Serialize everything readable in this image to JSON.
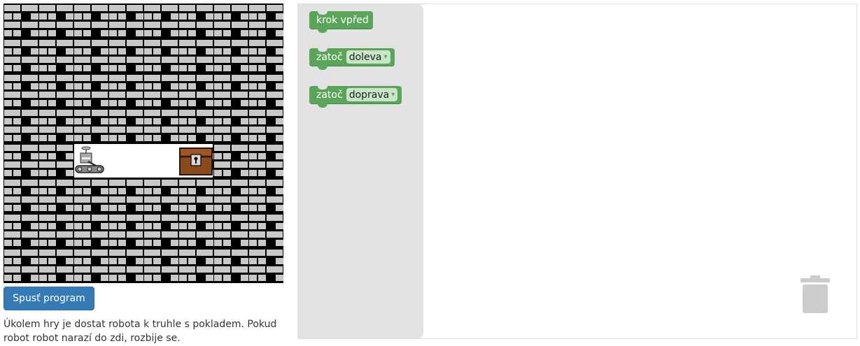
{
  "run_button": {
    "label": "Spusť program"
  },
  "task": {
    "text": "Úkolem hry je dostat robota k truhle s pokladem. Pokud robot robot narazí do zdi, rozbije se."
  },
  "toolbox": {
    "blocks": [
      {
        "label": "krok vpřed"
      },
      {
        "label": "zatoč",
        "value": "doleva"
      },
      {
        "label": "zatoč",
        "value": "doprava"
      }
    ]
  },
  "icons": {
    "dropdown": "▾",
    "trash": "trash-icon",
    "robot": "robot-icon",
    "chest": "treasure-chest-icon"
  },
  "maze": {
    "rows": 8,
    "cols": 8,
    "path_row": 4,
    "path_cols": [
      2,
      3,
      4,
      5
    ],
    "robot_col": 2,
    "chest_col": 5
  },
  "colors": {
    "button": "#337ab7",
    "block": "#5ba55b",
    "toolbox": "#e2e2e2",
    "brick": "#c8c8c8",
    "mortar": "#000000"
  }
}
